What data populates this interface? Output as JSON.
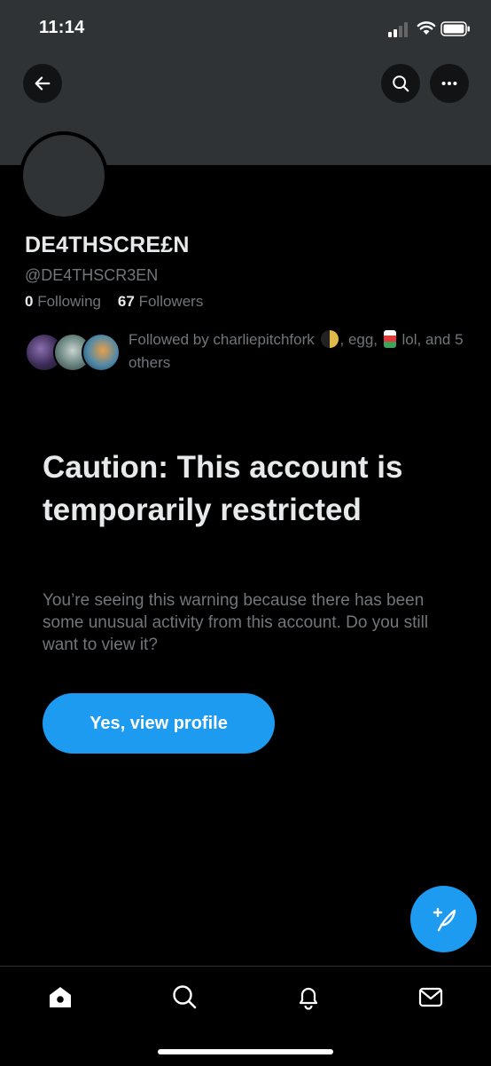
{
  "status_bar": {
    "time": "11:14"
  },
  "profile": {
    "display_name": "DE4THSCRE£N",
    "handle": "@DE4THSCR3EN",
    "following_count": "0",
    "following_label": "Following",
    "followers_count": "67",
    "followers_label": "Followers",
    "followed_by": {
      "prefix": "Followed by charliepitchfork",
      "name2": ", egg,",
      "name3": "lol,",
      "suffix": "and 5 others"
    }
  },
  "warning": {
    "title": "Caution: This account is temporarily restricted",
    "body": "You’re seeing this warning because there has been some unusual activity from this account. Do you still want to view it?",
    "button_label": "Yes, view profile"
  },
  "icons": {
    "back": "back-arrow-icon",
    "search": "search-icon",
    "more": "more-icon",
    "compose": "compose-icon",
    "tabs": [
      "home-icon",
      "search-icon",
      "notifications-icon",
      "messages-icon"
    ]
  },
  "colors": {
    "accent": "#1d9bf0",
    "banner": "#2f3336",
    "muted": "#71767b"
  }
}
